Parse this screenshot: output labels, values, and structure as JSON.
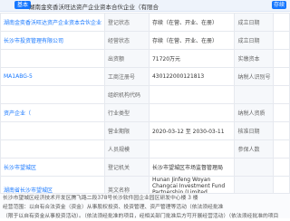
{
  "header": {
    "title": "湖南金奕香沃旺达资产企业资本合伙企业（有限合",
    "badge": "基本",
    "business_tag": "存续"
  },
  "rows": [
    {
      "c1": "湖南金奕香沃旺达资产企业资本合伙企业",
      "c2": "登记状态",
      "c3": "存续（在营、开业、在册）",
      "c4": "成立日期",
      "c5": ""
    },
    {
      "c1": "长沙市投资管理有限公司",
      "c2": "经营状态",
      "c3": "存续（在营、开业、在册）",
      "c4": "成立日期",
      "c5": ""
    },
    {
      "c1": "",
      "c2": "出资额",
      "c3": "71720万元",
      "c4": "实缴资本",
      "c5": ""
    },
    {
      "c1": "MA1ABG-5",
      "c2": "工商注册号",
      "c3": "430122000121813",
      "c4": "纳税人识别号",
      "c5": ""
    },
    {
      "c1": "",
      "c2": "组织机构代码",
      "c3": "",
      "c4": "",
      "c5": ""
    },
    {
      "c1": "资产企业（",
      "c2": "行业类型",
      "c3": "",
      "c4": "纳税人资质",
      "c5": ""
    },
    {
      "c1": "",
      "c2": "营业期限",
      "c3": "2020-03-12 至 2030-03-11",
      "c4": "核准日期",
      "c5": ""
    },
    {
      "c1": "",
      "c2": "人员规模",
      "c3": "",
      "c4": "参保人数",
      "c5": ""
    },
    {
      "c1": "长沙市望城区",
      "c2": "登记机关",
      "c3": "长沙市望城区市场监督管理局",
      "c4": "",
      "c5": ""
    },
    {
      "c1": "湖南省长沙市望城区",
      "c2": "英文名称",
      "c3": "Hunan Jinfeng Woyan Changcai Investment Fund Partnership (Limited Partnership)",
      "c4": "",
      "c5": ""
    }
  ],
  "summary": {
    "line1": "长沙市望城区经济技术开发区腾飞路二段378号长沙软件园企业园区研发中心楼 3 楼",
    "line2": "经营范围：以自有合法资金（资金）从事股权投资、投资管理、资产管理等活动（依法须经批准",
    "line3": "（限于以自有资金从事投资活动）。（依法须经批准的项目，经相关部门批准后方可开展经营活动）（依法须经批准的项目",
    "line4": "经营范围"
  }
}
